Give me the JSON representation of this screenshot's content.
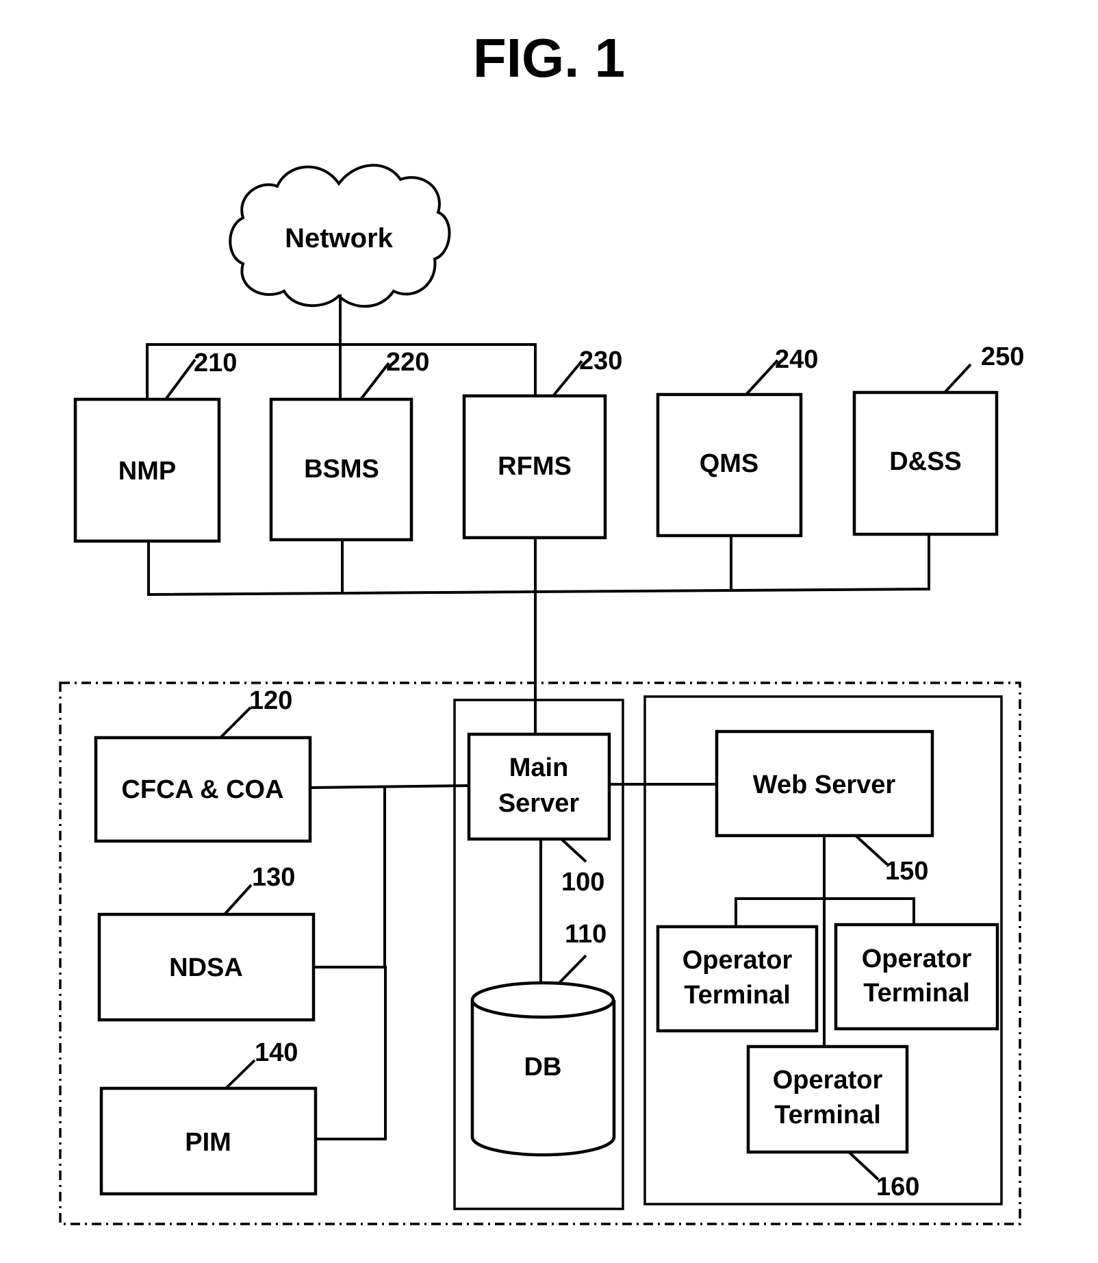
{
  "figure": {
    "title": "FIG. 1",
    "network": {
      "label": "Network"
    },
    "external_systems": [
      {
        "id": "nmp",
        "label": "NMP",
        "ref": "210"
      },
      {
        "id": "bsms",
        "label": "BSMS",
        "ref": "220"
      },
      {
        "id": "rfms",
        "label": "RFMS",
        "ref": "230"
      },
      {
        "id": "qms",
        "label": "QMS",
        "ref": "240"
      },
      {
        "id": "dss",
        "label": "D&SS",
        "ref": "250"
      }
    ],
    "left_group": [
      {
        "id": "cfca",
        "label": "CFCA & COA",
        "ref": "120"
      },
      {
        "id": "ndsa",
        "label": "NDSA",
        "ref": "130"
      },
      {
        "id": "pim",
        "label": "PIM",
        "ref": "140"
      }
    ],
    "center_group": {
      "main_server": {
        "line1": "Main",
        "line2": "Server",
        "ref": "100"
      },
      "db": {
        "label": "DB",
        "ref": "110"
      }
    },
    "right_group": {
      "web_server": {
        "label": "Web Server",
        "ref": "150"
      },
      "terminals": [
        {
          "line1": "Operator",
          "line2": "Terminal"
        },
        {
          "line1": "Operator",
          "line2": "Terminal"
        },
        {
          "line1": "Operator",
          "line2": "Terminal",
          "ref": "160"
        }
      ]
    }
  }
}
